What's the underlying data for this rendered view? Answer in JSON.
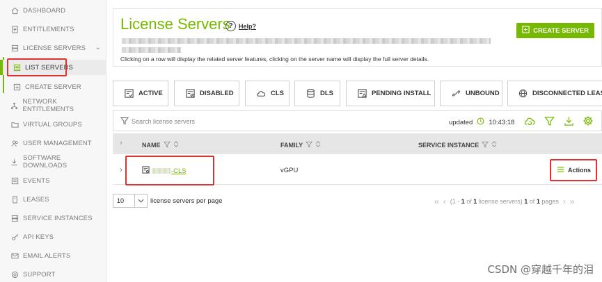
{
  "sidebar": {
    "items": [
      {
        "label": "DASHBOARD",
        "icon": "home-icon"
      },
      {
        "label": "ENTITLEMENTS",
        "icon": "document-icon"
      },
      {
        "label": "LICENSE SERVERS",
        "icon": "server-icon"
      },
      {
        "label": "LIST SERVERS",
        "icon": "list-icon"
      },
      {
        "label": "CREATE SERVER",
        "icon": "server-add-icon"
      },
      {
        "label": "NETWORK ENTITLEMENTS",
        "icon": "network-icon"
      },
      {
        "label": "VIRTUAL GROUPS",
        "icon": "folder-icon"
      },
      {
        "label": "USER MANAGEMENT",
        "icon": "users-icon"
      },
      {
        "label": "SOFTWARE DOWNLOADS",
        "icon": "download-icon"
      },
      {
        "label": "EVENTS",
        "icon": "events-icon"
      },
      {
        "label": "LEASES",
        "icon": "lease-icon"
      },
      {
        "label": "SERVICE INSTANCES",
        "icon": "service-icon"
      },
      {
        "label": "API KEYS",
        "icon": "key-icon"
      },
      {
        "label": "EMAIL ALERTS",
        "icon": "mail-icon"
      },
      {
        "label": "SUPPORT",
        "icon": "support-icon"
      }
    ]
  },
  "header": {
    "title": "License Servers",
    "help_label": "Help?",
    "hint": "Clicking on a row will display the related server features, clicking on the server name will display the full server details.",
    "create_label": "CREATE SERVER"
  },
  "filters": [
    {
      "label": "ACTIVE",
      "icon": "server-check-icon"
    },
    {
      "label": "DISABLED",
      "icon": "server-disabled-icon"
    },
    {
      "label": "CLS",
      "icon": "cloud-icon"
    },
    {
      "label": "DLS",
      "icon": "database-icon"
    },
    {
      "label": "PENDING INSTALL",
      "icon": "pending-install-icon"
    },
    {
      "label": "UNBOUND",
      "icon": "unlink-icon"
    },
    {
      "label": "DISCONNECTED LEASING",
      "icon": "globe-icon"
    }
  ],
  "toolbar": {
    "search_placeholder": "Search license servers",
    "updated_label": "updated",
    "updated_time": "10:43:18"
  },
  "table": {
    "columns": [
      "NAME",
      "FAMILY",
      "SERVICE INSTANCE"
    ],
    "rows": [
      {
        "name": "-CLS",
        "family": "vGPU",
        "service_instance": "",
        "actions_label": "Actions"
      }
    ]
  },
  "pagination": {
    "page_size": "10",
    "page_size_label": "license servers per page",
    "summary_prefix": "(1 - ",
    "summary_of1": "1",
    "summary_mid": " of ",
    "summary_total": "1",
    "summary_suffix": " license servers) ",
    "current_page": "1",
    "of_label": " of ",
    "page_count": "1",
    "pages_label": " pages"
  },
  "watermark": "CSDN @穿越千年的泪",
  "colors": {
    "accent": "#76b900",
    "highlight": "#e03131"
  }
}
